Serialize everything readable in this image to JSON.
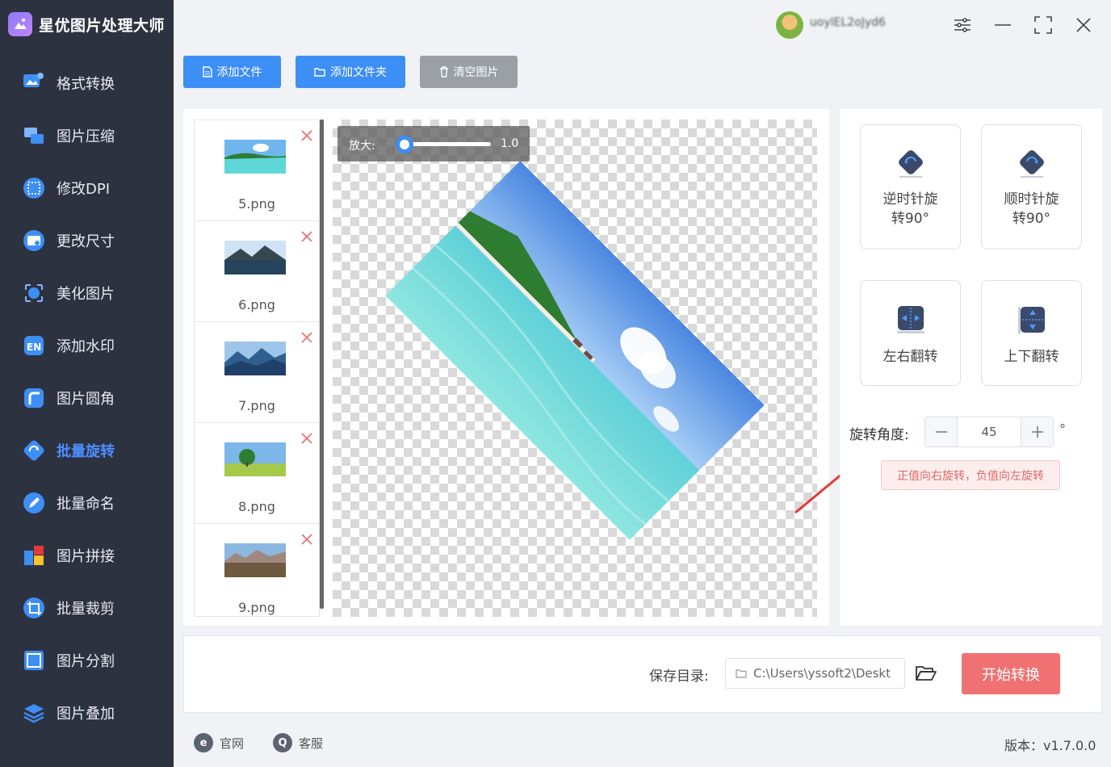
{
  "app": {
    "title": "星优图片处理大师"
  },
  "sidebar": {
    "items": [
      {
        "label": "格式转换",
        "icon": "format-convert-icon",
        "color": "#3d8ef5"
      },
      {
        "label": "图片压缩",
        "icon": "compress-icon",
        "color": "#3d8ef5"
      },
      {
        "label": "修改DPI",
        "icon": "dpi-icon",
        "color": "#3d8ef5"
      },
      {
        "label": "更改尺寸",
        "icon": "resize-icon",
        "color": "#3d8ef5"
      },
      {
        "label": "美化图片",
        "icon": "beautify-icon",
        "color": "#3d8ef5"
      },
      {
        "label": "添加水印",
        "icon": "watermark-icon",
        "color": "#3d8ef5"
      },
      {
        "label": "图片圆角",
        "icon": "round-corner-icon",
        "color": "#3d8ef5"
      },
      {
        "label": "批量旋转",
        "icon": "rotate-icon",
        "color": "#3d8ef5",
        "active": true
      },
      {
        "label": "批量命名",
        "icon": "rename-icon",
        "color": "#3d8ef5"
      },
      {
        "label": "图片拼接",
        "icon": "stitch-icon",
        "color": "#3d8ef5"
      },
      {
        "label": "批量裁剪",
        "icon": "crop-icon",
        "color": "#3d8ef5"
      },
      {
        "label": "图片分割",
        "icon": "split-icon",
        "color": "#3d8ef5"
      },
      {
        "label": "图片叠加",
        "icon": "overlay-icon",
        "color": "#3d8ef5"
      }
    ]
  },
  "header": {
    "username": "uoylEL2oJyd6"
  },
  "toolbar": {
    "add_file": "添加文件",
    "add_folder": "添加文件夹",
    "clear_images": "清空图片"
  },
  "files": [
    {
      "name": "5.png",
      "thumb": "beach"
    },
    {
      "name": "6.png",
      "thumb": "lake-mountain"
    },
    {
      "name": "7.png",
      "thumb": "blue-mountains"
    },
    {
      "name": "8.png",
      "thumb": "tree-field"
    },
    {
      "name": "9.png",
      "thumb": "mountain-lake"
    }
  ],
  "preview": {
    "zoom_label": "放大:",
    "zoom_value": "1.0",
    "zoom_level": 0.1,
    "rotation_deg": 45
  },
  "tools": {
    "rotate_ccw": "逆时针旋\n转90°",
    "rotate_cw": "顺时针旋\n转90°",
    "flip_h": "左右翻转",
    "flip_v": "上下翻转"
  },
  "angle": {
    "label": "旋转角度:",
    "value": "45",
    "unit": "°",
    "hint": "正值向右旋转，负值向左旋转"
  },
  "save": {
    "label": "保存目录:",
    "path": "C:\\Users\\yssoft2\\Deskt"
  },
  "start_button": "开始转换",
  "footer": {
    "website": "官网",
    "service": "客服",
    "version": "版本：v1.7.0.0"
  },
  "colors": {
    "accent": "#3d8ef5",
    "start": "#f07171",
    "sidebar": "#2d3240"
  }
}
